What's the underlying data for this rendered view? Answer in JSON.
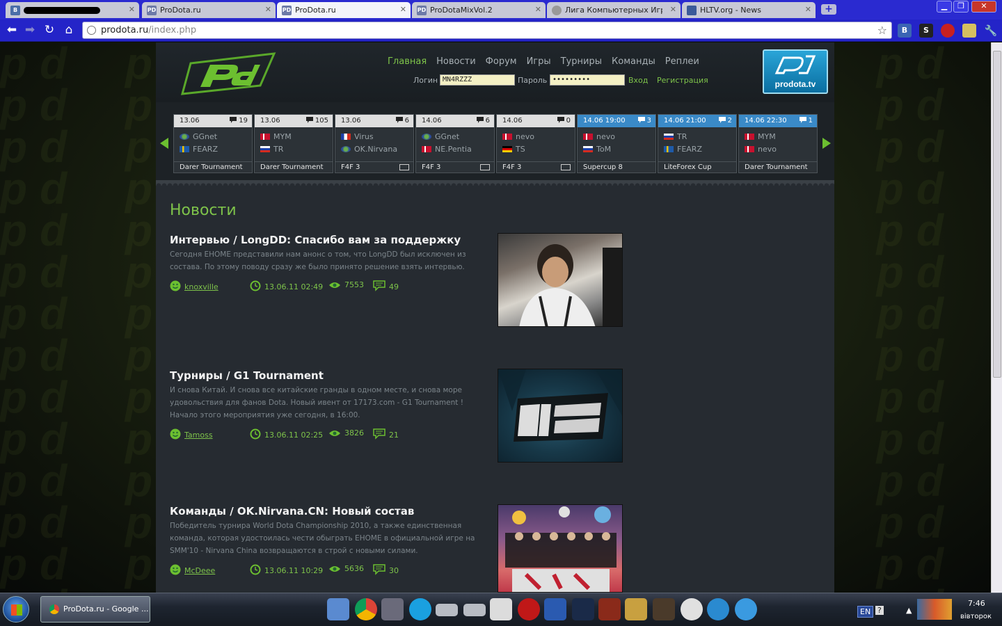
{
  "browser": {
    "tabs": [
      {
        "title": "",
        "icon": "vk-icon",
        "redacted": true
      },
      {
        "title": "ProDota.ru",
        "icon": "pd-icon"
      },
      {
        "title": "ProDota.ru",
        "icon": "pd-icon",
        "active": true
      },
      {
        "title": "ProDotaMixVol.2",
        "icon": "pd-icon"
      },
      {
        "title": "Лига Компьютерных Игр Inte",
        "icon": "league-icon"
      },
      {
        "title": "HLTV.org - News",
        "icon": "hltv-icon"
      }
    ],
    "url_host": "prodota.ru",
    "url_path": "/index.php",
    "extensions": [
      "B",
      "S",
      "A",
      "C",
      "W"
    ]
  },
  "site": {
    "nav": [
      "Главная",
      "Новости",
      "Форум",
      "Игры",
      "Турниры",
      "Команды",
      "Реплеи"
    ],
    "login": {
      "login_label": "Логин",
      "login_value": "MN4RZZZ",
      "password_label": "Пароль",
      "password_value": "•••••••••",
      "enter": "Вход",
      "register": "Регистрация"
    },
    "tv_logo_text": "prodota.tv"
  },
  "matches": [
    {
      "date": "13.06",
      "comments": "19",
      "team1": "GGnet",
      "team2": "FEARZ",
      "flag1": "eu",
      "flag2": "se",
      "event": "Darer Tournament",
      "live": false,
      "video": false
    },
    {
      "date": "13.06",
      "comments": "105",
      "team1": "MYM",
      "team2": "TR",
      "flag1": "dk",
      "flag2": "ru",
      "event": "Darer Tournament",
      "live": false,
      "video": false
    },
    {
      "date": "13.06",
      "comments": "6",
      "team1": "Virus",
      "team2": "OK.Nirvana",
      "flag1": "fr",
      "flag2": "eu",
      "event": "F4F 3",
      "live": false,
      "video": true
    },
    {
      "date": "14.06",
      "comments": "6",
      "team1": "GGnet",
      "team2": "NE.Pentia",
      "flag1": "eu",
      "flag2": "dk",
      "event": "F4F 3",
      "live": false,
      "video": true
    },
    {
      "date": "14.06",
      "comments": "0",
      "team1": "nevo",
      "team2": "TS",
      "flag1": "dk",
      "flag2": "de",
      "event": "F4F 3",
      "live": false,
      "video": true
    },
    {
      "date": "14.06 19:00",
      "comments": "3",
      "team1": "nevo",
      "team2": "ToM",
      "flag1": "dk",
      "flag2": "ru",
      "event": "Supercup 8",
      "live": true,
      "video": false
    },
    {
      "date": "14.06 21:00",
      "comments": "2",
      "team1": "TR",
      "team2": "FEARZ",
      "flag1": "ru",
      "flag2": "se",
      "event": "LiteForex Cup",
      "live": true,
      "video": false
    },
    {
      "date": "14.06 22:30",
      "comments": "1",
      "team1": "MYM",
      "team2": "nevo",
      "flag1": "dk",
      "flag2": "dk",
      "event": "Darer Tournament",
      "live": true,
      "video": false
    }
  ],
  "news": {
    "heading": "Новости",
    "articles": [
      {
        "title": "Интервью / LongDD: Спасибо вам за поддержку",
        "excerpt": "Сегодня EHOME представили нам анонс о том, что LongDD был исключен из состава. По этому поводу сразу же было принято решение взять интервью.",
        "author": "knoxville",
        "datetime": "13.06.11 02:49",
        "views": "7553",
        "comments": "49"
      },
      {
        "title": "Турниры / G1 Tournament",
        "excerpt": "И снова Китай. И снова все китайские гранды в одном месте, и снова море удовольствия для фанов Dota. Новый ивент от 17173.com - G1 Tournament ! Начало этого мероприятия уже сегодня, в 16:00.",
        "author": "Tamoss",
        "datetime": "13.06.11 02:25",
        "views": "3826",
        "comments": "21"
      },
      {
        "title": "Команды / OK.Nirvana.CN: Новый состав",
        "excerpt": "Победитель турнира World Dota Championship 2010, а также единственная команда, которая удостоилась чести обыграть EHOME в официальной игре на SMM'10 - Nirvana China возвращаются в строй с новыми силами.",
        "author": "McDeee",
        "datetime": "13.06.11 10:29",
        "views": "5636",
        "comments": "30"
      }
    ]
  },
  "taskbar": {
    "task_title": "ProDota.ru - Google ...",
    "lang": "EN",
    "time": "7:46",
    "day": "вівторок"
  }
}
